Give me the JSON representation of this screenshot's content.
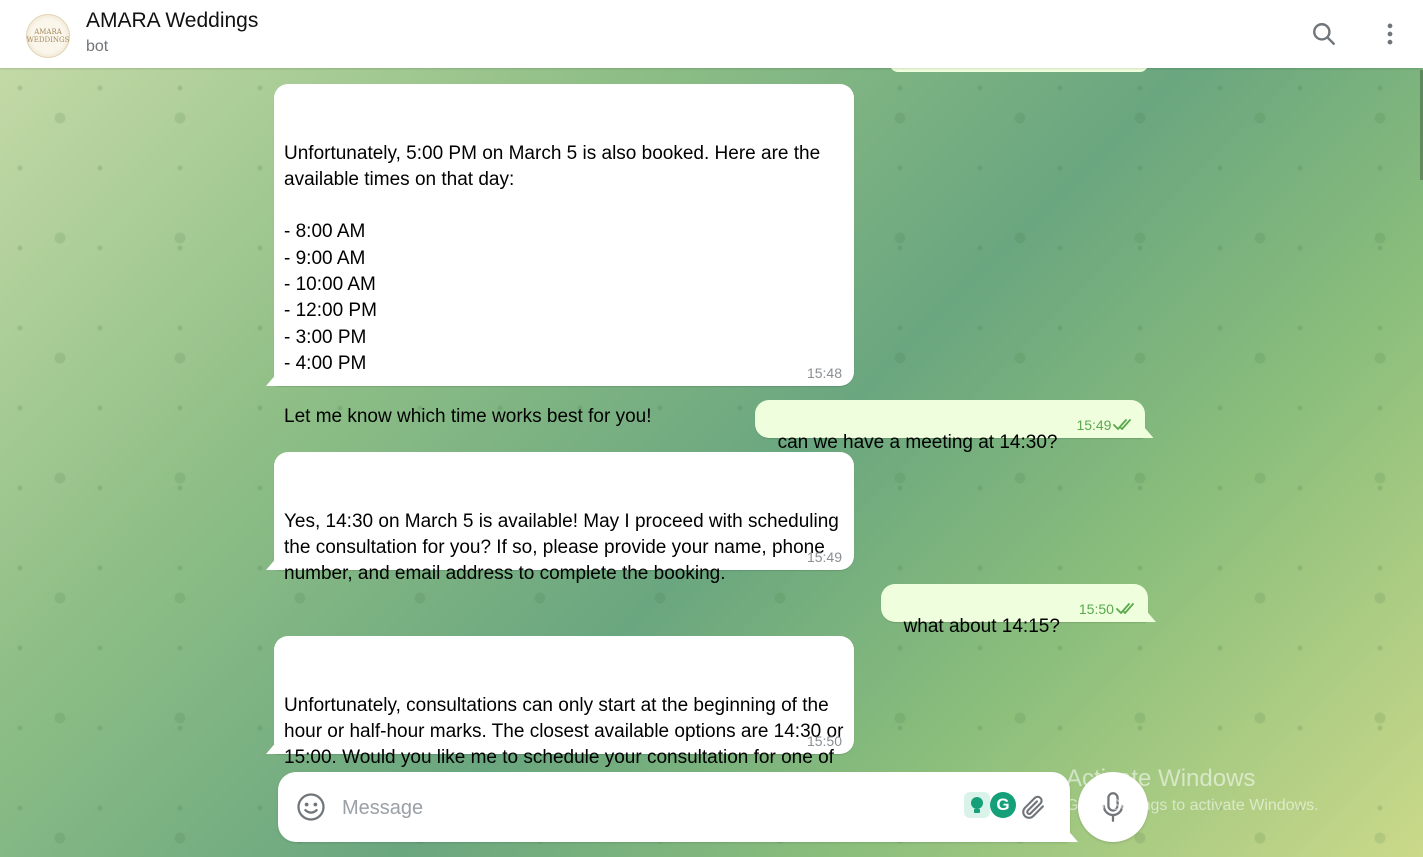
{
  "header": {
    "avatar_text": "AMARA WEDDINGS",
    "title": "AMARA Weddings",
    "subtitle": "bot"
  },
  "messages": [
    {
      "direction": "in",
      "text": "Unfortunately, 5:00 PM on March 5 is also booked. Here are the available times on that day:\n\n- 8:00 AM\n- 9:00 AM\n- 10:00 AM\n- 12:00 PM\n- 3:00 PM\n- 4:00 PM\n\nLet me know which time works best for you!",
      "time": "15:48"
    },
    {
      "direction": "out",
      "text": "can we have a meeting at 14:30?",
      "time": "15:49",
      "status": "read"
    },
    {
      "direction": "in",
      "text": "Yes, 14:30 on March 5 is available! May I proceed with scheduling the consultation for you? If so, please provide your name, phone number, and email address to complete the booking.",
      "time": "15:49"
    },
    {
      "direction": "out",
      "text": "what about 14:15?",
      "time": "15:50",
      "status": "read"
    },
    {
      "direction": "in",
      "text": "Unfortunately, consultations can only start at the beginning of the hour or half-hour marks. The closest available options are 14:30 or 15:00. Would you like me to schedule your consultation for one of these times? Let me know!",
      "time": "15:50"
    }
  ],
  "composer": {
    "placeholder": "Message",
    "value": ""
  },
  "watermark": {
    "line1": "Activate Windows",
    "line2": "Go to Settings to activate Windows."
  },
  "icons": [
    "search-icon",
    "more-vertical-icon",
    "emoji-icon",
    "attach-icon",
    "microphone-icon",
    "read-checkmarks-icon",
    "grammarly-icon",
    "lightbulb-icon"
  ],
  "colors": {
    "outgoing_bubble": "#effedd",
    "incoming_bubble": "#ffffff",
    "outgoing_time": "#5aa84e",
    "grammarly": "#15a079"
  }
}
